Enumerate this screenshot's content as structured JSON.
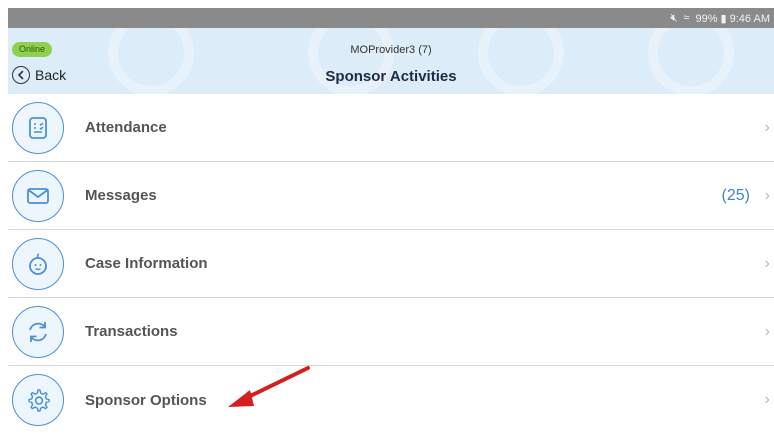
{
  "status_bar": {
    "text": "99% ▮ 9:46 AM",
    "icons": [
      "mute-icon",
      "wifi-icon",
      "battery-icon"
    ]
  },
  "header": {
    "online_badge": "Online",
    "back_label": "Back",
    "provider": "MOProvider3 (7)",
    "title": "Sponsor Activities"
  },
  "menu": {
    "items": [
      {
        "label": "Attendance",
        "icon": "attendance-icon",
        "count": ""
      },
      {
        "label": "Messages",
        "icon": "envelope-icon",
        "count": "(25)"
      },
      {
        "label": "Case Information",
        "icon": "baby-face-icon",
        "count": ""
      },
      {
        "label": "Transactions",
        "icon": "refresh-icon",
        "count": ""
      },
      {
        "label": "Sponsor Options",
        "icon": "gear-icon",
        "count": ""
      }
    ]
  },
  "colors": {
    "header_bg": "#dcecf8",
    "accent": "#3c86d6",
    "online_badge": "#8fd14f",
    "arrow": "#d31f1f"
  }
}
